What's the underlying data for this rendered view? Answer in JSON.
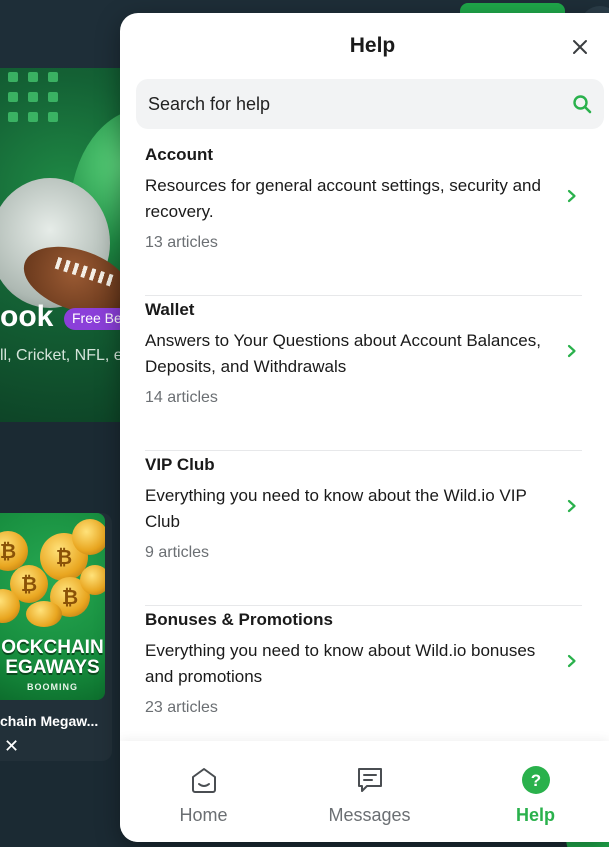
{
  "background": {
    "hero": {
      "title": "ook",
      "badge": "Free Be",
      "subtitle": "ll, Cricket, NFL, e"
    },
    "game_card": {
      "art_title_line1": "OCKCHAIN",
      "art_title_line2": "EGAWAYS",
      "art_brand": "BOOMING",
      "name": "chain Megaw...",
      "close_glyph": "✕"
    }
  },
  "help_panel": {
    "title": "Help",
    "search": {
      "placeholder": "Search for help"
    },
    "collections": [
      {
        "title": "Account",
        "description": "Resources for general account settings, security and recovery.",
        "count": "13 articles"
      },
      {
        "title": "Wallet",
        "description": "Answers to Your Questions about Account Balances, Deposits, and Withdrawals",
        "count": "14 articles"
      },
      {
        "title": "VIP Club",
        "description": "Everything you need to know about the Wild.io VIP Club",
        "count": "9 articles"
      },
      {
        "title": "Bonuses & Promotions",
        "description": "Everything you need to know about Wild.io bonuses and promotions",
        "count": "23 articles"
      }
    ],
    "tabs": [
      {
        "label": "Home",
        "icon": "home-icon",
        "active": false
      },
      {
        "label": "Messages",
        "icon": "messages-icon",
        "active": false
      },
      {
        "label": "Help",
        "icon": "help-icon",
        "active": true
      }
    ]
  },
  "colors": {
    "accent": "#2ab14c",
    "panel_bg": "#ffffff",
    "search_bg": "#f2f3f4",
    "page_bg": "#1b2a33"
  }
}
